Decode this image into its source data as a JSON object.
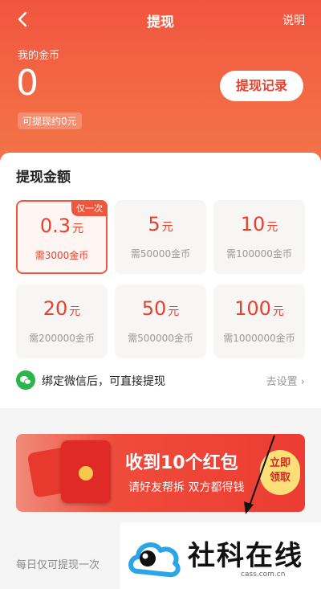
{
  "header": {
    "title": "提现",
    "help": "说明",
    "coin_label": "我的金币",
    "coin_value": "0",
    "approx": "可提现约0元",
    "record_button": "提现记录",
    "gradient_top": "#f2553f",
    "gradient_bottom": "#f37548"
  },
  "amount_section": {
    "title": "提现金额",
    "options": [
      {
        "amount": "0.3",
        "unit": "元",
        "cost": "需3000金币",
        "tag": "仅一次",
        "selected": true
      },
      {
        "amount": "5",
        "unit": "元",
        "cost": "需50000金币"
      },
      {
        "amount": "10",
        "unit": "元",
        "cost": "需100000金币"
      },
      {
        "amount": "20",
        "unit": "元",
        "cost": "需200000金币"
      },
      {
        "amount": "50",
        "unit": "元",
        "cost": "需500000金币"
      },
      {
        "amount": "100",
        "unit": "元",
        "cost": "需1000000金币"
      }
    ],
    "bind_text": "绑定微信后，可直接提现",
    "go_settings": "去设置 ›",
    "wechat_icon": "wechat-icon"
  },
  "banner": {
    "title": "收到10个红包",
    "subtitle": "请好友帮拆  双方都得钱",
    "claim_line1": "立即",
    "claim_line2": "领取"
  },
  "bottom_note": "每日仅可提现一次",
  "watermark": {
    "text": "社科在线",
    "url": "cass.com.cn"
  },
  "colors": {
    "accent": "#e8402c",
    "wechat": "#2bb64a"
  }
}
